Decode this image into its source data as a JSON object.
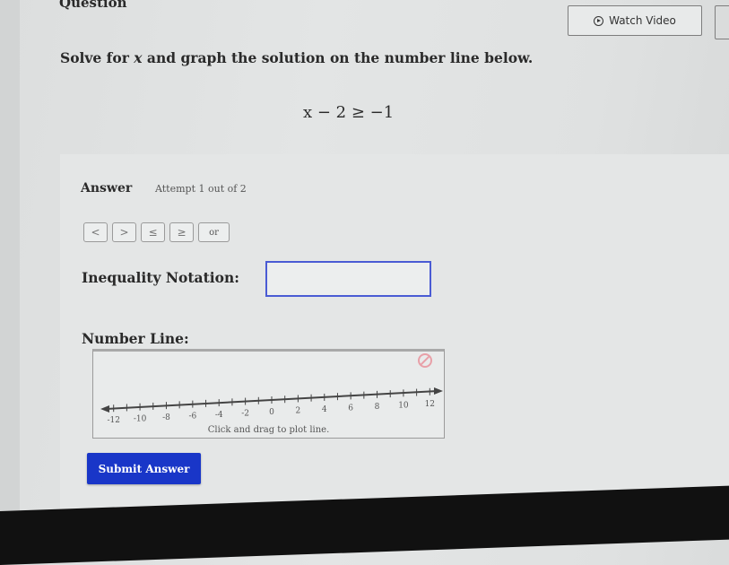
{
  "header": {
    "question_label": "Question",
    "watch_video_label": "Watch Video",
    "watch_video_icon": "play-circle-icon"
  },
  "question": {
    "prompt_before": "Solve for ",
    "prompt_var": "x",
    "prompt_after": " and graph the solution on the number line below.",
    "equation": "x − 2 ≥ −1"
  },
  "answer": {
    "label": "Answer",
    "attempt": "Attempt 1 out of 2",
    "symbols": [
      "<",
      ">",
      "≤",
      "≥",
      "or"
    ],
    "inequality_label": "Inequality Notation:",
    "inequality_value": "",
    "number_line_label": "Number Line:",
    "number_line_hint": "Click and drag to plot line.",
    "clear_icon": "clear-icon",
    "submit_label": "Submit Answer"
  },
  "number_line": {
    "min": -13,
    "max": 13,
    "tick_step": 1,
    "labels": [
      "-12",
      "-10",
      "-8",
      "-6",
      "-4",
      "-2",
      "0",
      "2",
      "4",
      "6",
      "8",
      "10",
      "12"
    ],
    "label_values": [
      -12,
      -10,
      -8,
      -6,
      -4,
      -2,
      0,
      2,
      4,
      6,
      8,
      10,
      12
    ]
  }
}
